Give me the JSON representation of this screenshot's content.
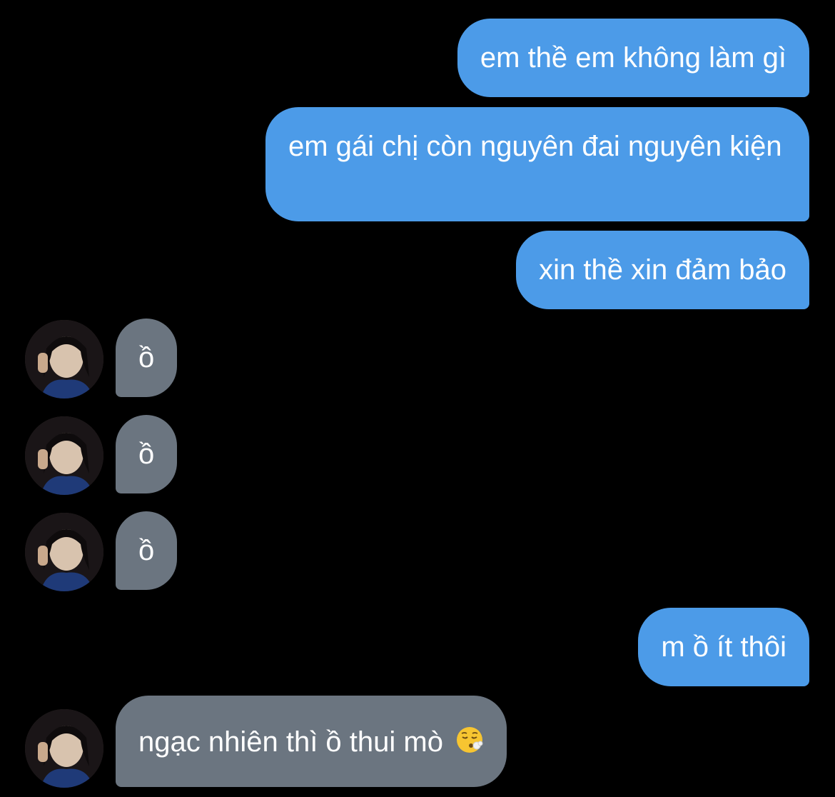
{
  "messages": [
    {
      "id": "m1",
      "direction": "outgoing",
      "text": "em thề em không làm gì"
    },
    {
      "id": "m2",
      "direction": "outgoing",
      "text": "em gái chị còn nguyên đai nguyên kiện"
    },
    {
      "id": "m3",
      "direction": "outgoing",
      "text": "xin thề xin đảm bảo"
    },
    {
      "id": "m4",
      "direction": "incoming",
      "text": "ồ"
    },
    {
      "id": "m5",
      "direction": "incoming",
      "text": "ồ"
    },
    {
      "id": "m6",
      "direction": "incoming",
      "text": "ồ"
    },
    {
      "id": "m7",
      "direction": "outgoing",
      "text": "m ồ ít thôi"
    },
    {
      "id": "m8",
      "direction": "incoming",
      "text": "ngạc nhiên thì ồ thui mò",
      "emoji": "face-exhaling-emoji"
    }
  ],
  "colors": {
    "background": "#000000",
    "outgoing_bubble": "#4c9be8",
    "incoming_bubble": "#6b7580",
    "text": "#ffffff"
  },
  "icons": {
    "avatar": "contact-avatar-photo",
    "emoji": "face-exhaling-emoji"
  }
}
